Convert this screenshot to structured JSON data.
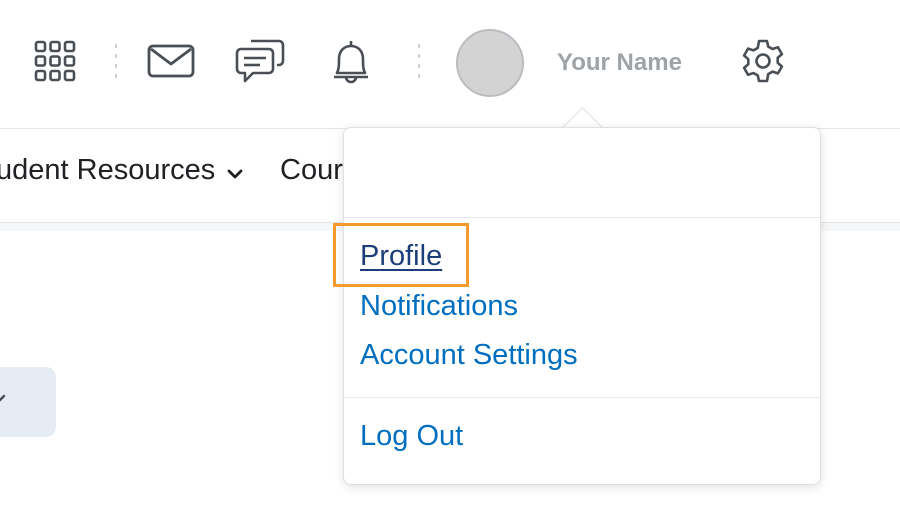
{
  "topbar": {
    "icons": [
      "apps-grid-icon",
      "mail-icon",
      "chat-icon",
      "bell-icon",
      "gear-icon"
    ],
    "user_name": "Your Name"
  },
  "navbar": {
    "items": [
      {
        "label": "udent Resources",
        "has_dropdown": true
      },
      {
        "label": "Cour"
      }
    ]
  },
  "user_menu": {
    "items": [
      {
        "label": "Profile",
        "state": "focused"
      },
      {
        "label": "Notifications"
      },
      {
        "label": "Account Settings"
      },
      {
        "label": "Log Out"
      }
    ]
  },
  "colors": {
    "link": "#006fbf",
    "link_active": "#1c3f7a",
    "focus": "#f29a2e",
    "username": "#9ea3a8"
  }
}
